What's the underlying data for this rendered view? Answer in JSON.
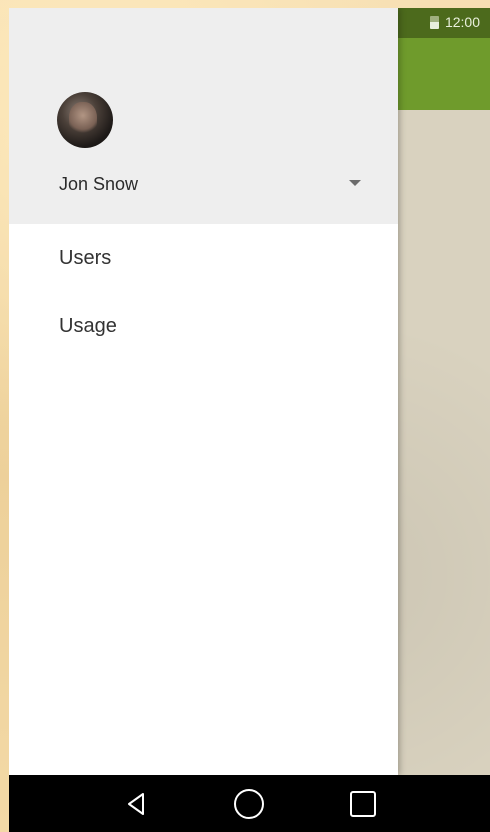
{
  "status_bar": {
    "time": "12:00",
    "battery_icon": "battery-icon"
  },
  "drawer": {
    "account": {
      "name": "Jon Snow",
      "avatar_icon": "avatar"
    },
    "menu": [
      {
        "label": "Users"
      },
      {
        "label": "Usage"
      }
    ]
  },
  "nav_bar": {
    "back_icon": "back-icon",
    "home_icon": "home-icon",
    "recents_icon": "recents-icon"
  },
  "colors": {
    "status_bar": "#4c6a1c",
    "app_bar": "#6f9b2c",
    "drawer_header": "#eeeeee",
    "drawer": "#ffffff",
    "nav_bar": "#000000"
  }
}
